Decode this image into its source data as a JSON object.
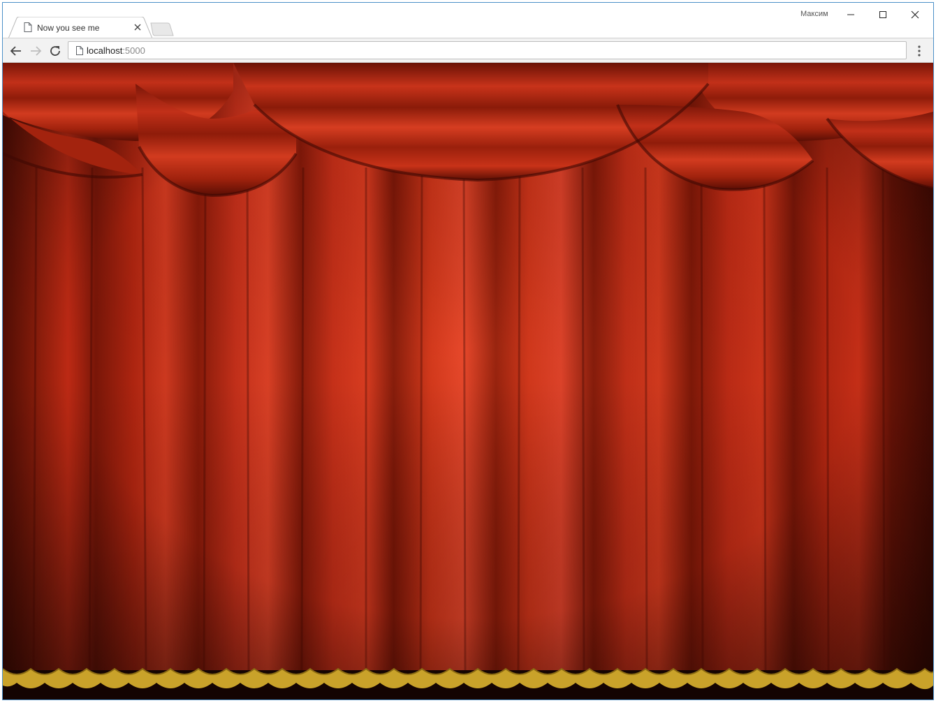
{
  "window": {
    "profile_name": "Максим"
  },
  "tabs": [
    {
      "title": "Now you see me",
      "icon": "page-icon",
      "active": true
    }
  ],
  "toolbar": {
    "url_host": "localhost",
    "url_port": ":5000"
  },
  "page": {
    "content": "red-stage-curtain-image",
    "colors": {
      "curtain_red": "#c9301a",
      "curtain_dark": "#6e1206",
      "fringe_gold": "#c9a22a"
    }
  }
}
